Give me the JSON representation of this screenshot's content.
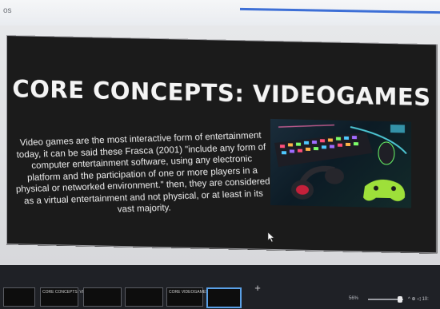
{
  "window": {
    "corner_text": "os"
  },
  "slide": {
    "title": "CORE CONCEPTS: VIDEOGAMES",
    "body": "Video games are the most interactive form of entertainment today, it can be said these Frasca (2001) \"include any form of computer entertainment software, using any electronic platform and the participation of one or more players in a physical or networked environment.\" then, they are considered as a virtual entertainment and not physical, or at least in its vast majority.",
    "image_icon": "gaming-setup-photo"
  },
  "thumbnails": [
    {
      "label": ""
    },
    {
      "label": "CORE CONCEPTS: VIDEOGAMES"
    },
    {
      "label": ""
    },
    {
      "label": ""
    },
    {
      "label": "CORE VIDEOGAMES"
    },
    {
      "label": ""
    }
  ],
  "add_slide_label": "+",
  "status": {
    "zoom": "56%",
    "tray": "^ ⊕ ◁ 10:"
  },
  "colors": {
    "slide_bg": "#1b1b1b",
    "title": "#f4f4f4",
    "accent": "#3d6fd6"
  }
}
